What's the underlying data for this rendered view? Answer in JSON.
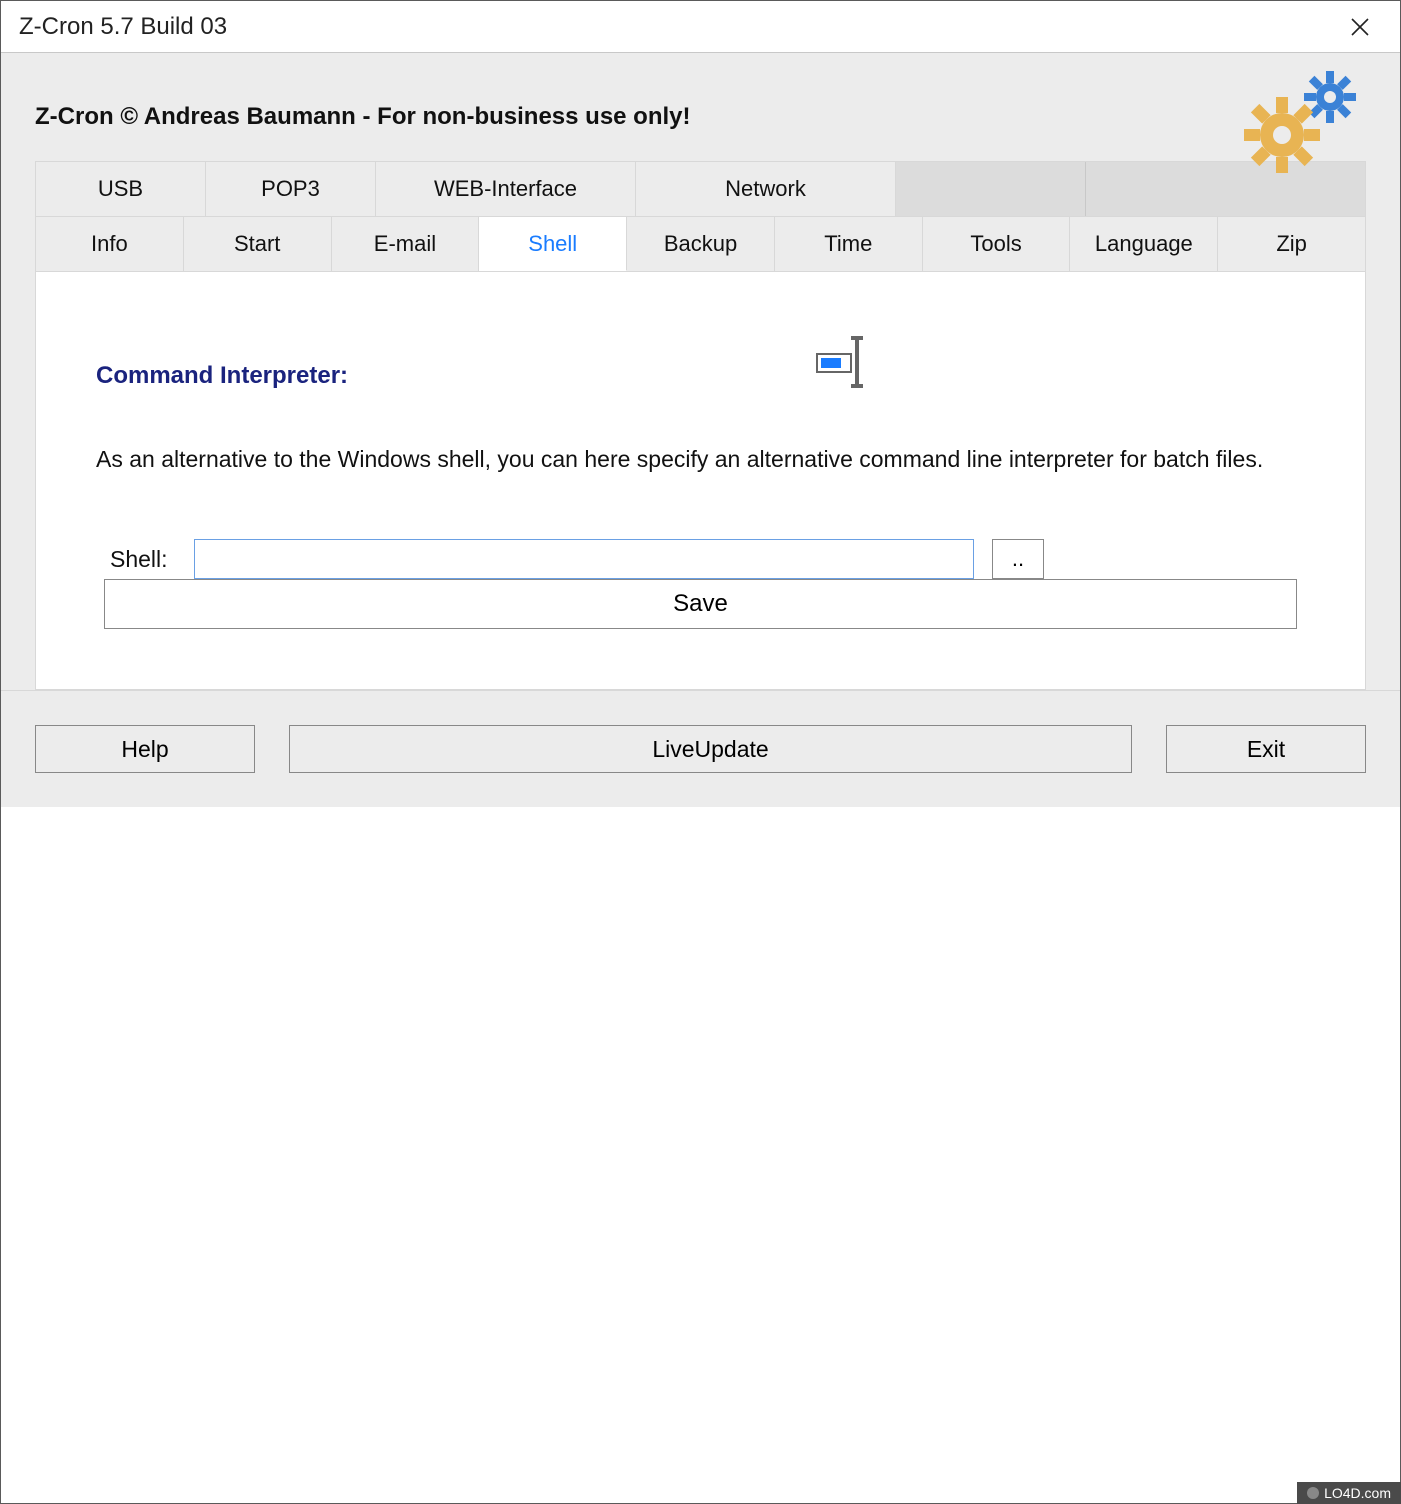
{
  "window": {
    "title": "Z-Cron 5.7 Build 03"
  },
  "header": {
    "text": "Z-Cron © Andreas Baumann - For non-business use only!"
  },
  "tabsRow1": [
    {
      "label": "USB"
    },
    {
      "label": "POP3"
    },
    {
      "label": "WEB-Interface"
    },
    {
      "label": "Network"
    },
    {
      "label": ""
    },
    {
      "label": ""
    }
  ],
  "tabsRow2": [
    {
      "label": "Info"
    },
    {
      "label": "Start"
    },
    {
      "label": "E-mail"
    },
    {
      "label": "Shell",
      "active": true
    },
    {
      "label": "Backup"
    },
    {
      "label": "Time"
    },
    {
      "label": "Tools"
    },
    {
      "label": "Language"
    },
    {
      "label": "Zip"
    }
  ],
  "section": {
    "heading": "Command Interpreter:",
    "description": "As an alternative to the Windows shell, you can here specify an alternative command line interpreter for batch files."
  },
  "field": {
    "label": "Shell:",
    "value": "",
    "browse": ".."
  },
  "buttons": {
    "save": "Save",
    "help": "Help",
    "liveupdate": "LiveUpdate",
    "exit": "Exit"
  },
  "watermark": "LO4D.com"
}
